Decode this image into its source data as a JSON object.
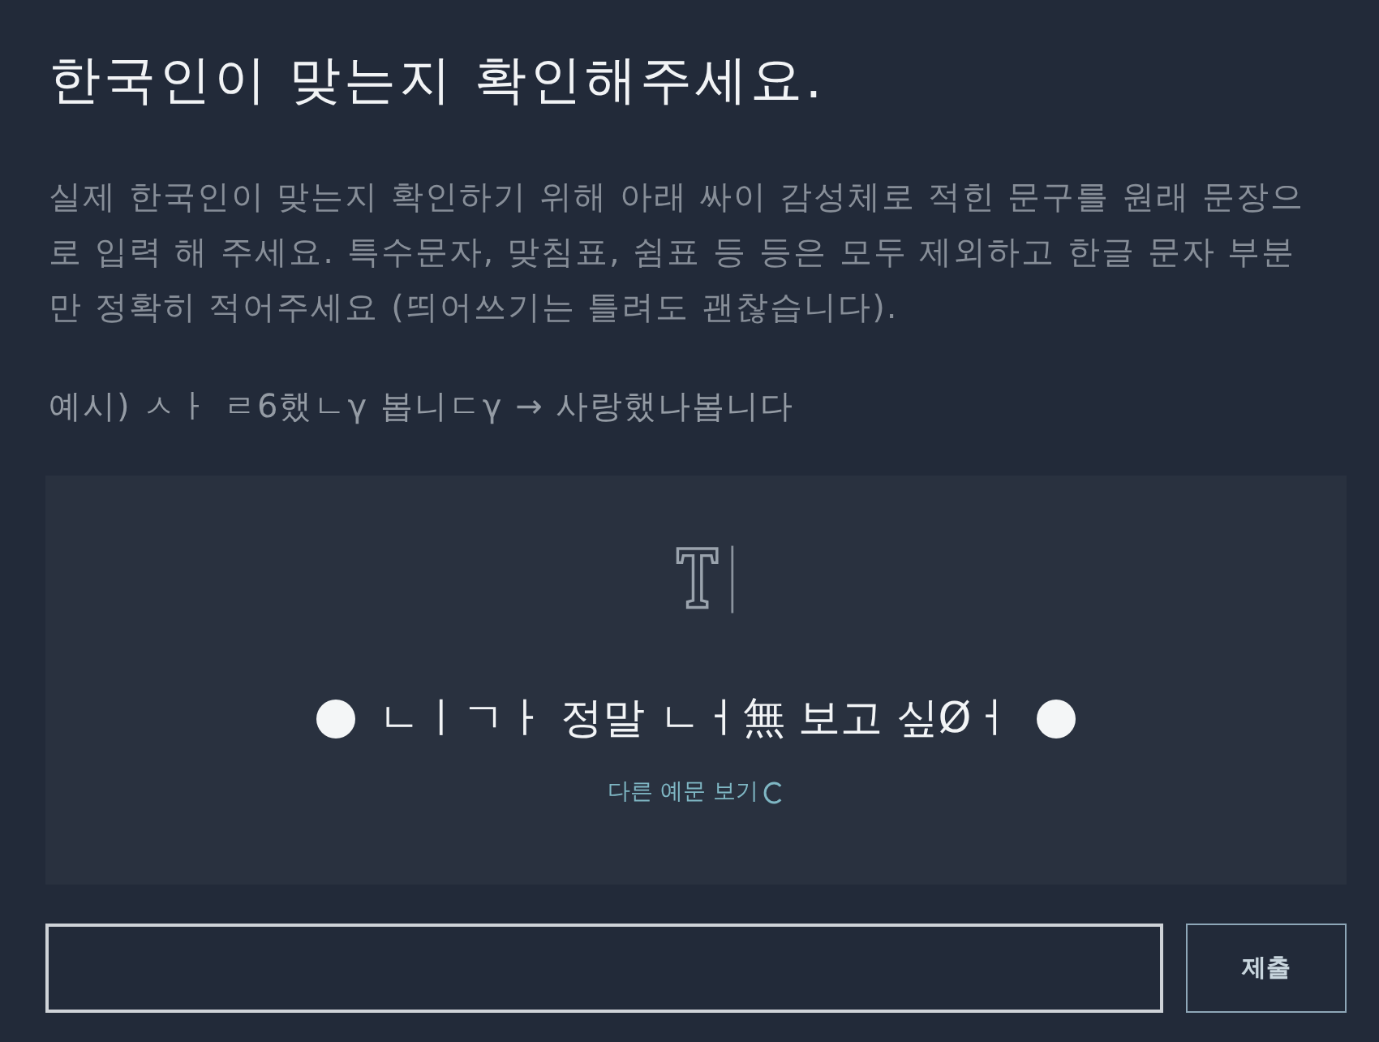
{
  "title": "한국인이 맞는지 확인해주세요.",
  "instructions": "실제 한국인이 맞는지 확인하기 위해 아래 싸이 감성체로 적힌 문구를 원래 문장으로 입력 해 주세요. 특수문자, 맞침표, 쉼표 등 등은 모두 제외하고 한글 문자 부분만 정확히 적어주세요 (띄어쓰기는 틀려도 괜찮습니다).",
  "example": "예시) ㅅㅏ ㄹ6했ㄴγ 봅니ㄷγ → 사랑했나봅니다",
  "captcha": {
    "text": "ㄴㅣㄱㅏ 정말 ㄴㅓ無 보고 싶Øㅓ",
    "refresh_link": "다른 예문 보기"
  },
  "submit_button": "제출"
}
